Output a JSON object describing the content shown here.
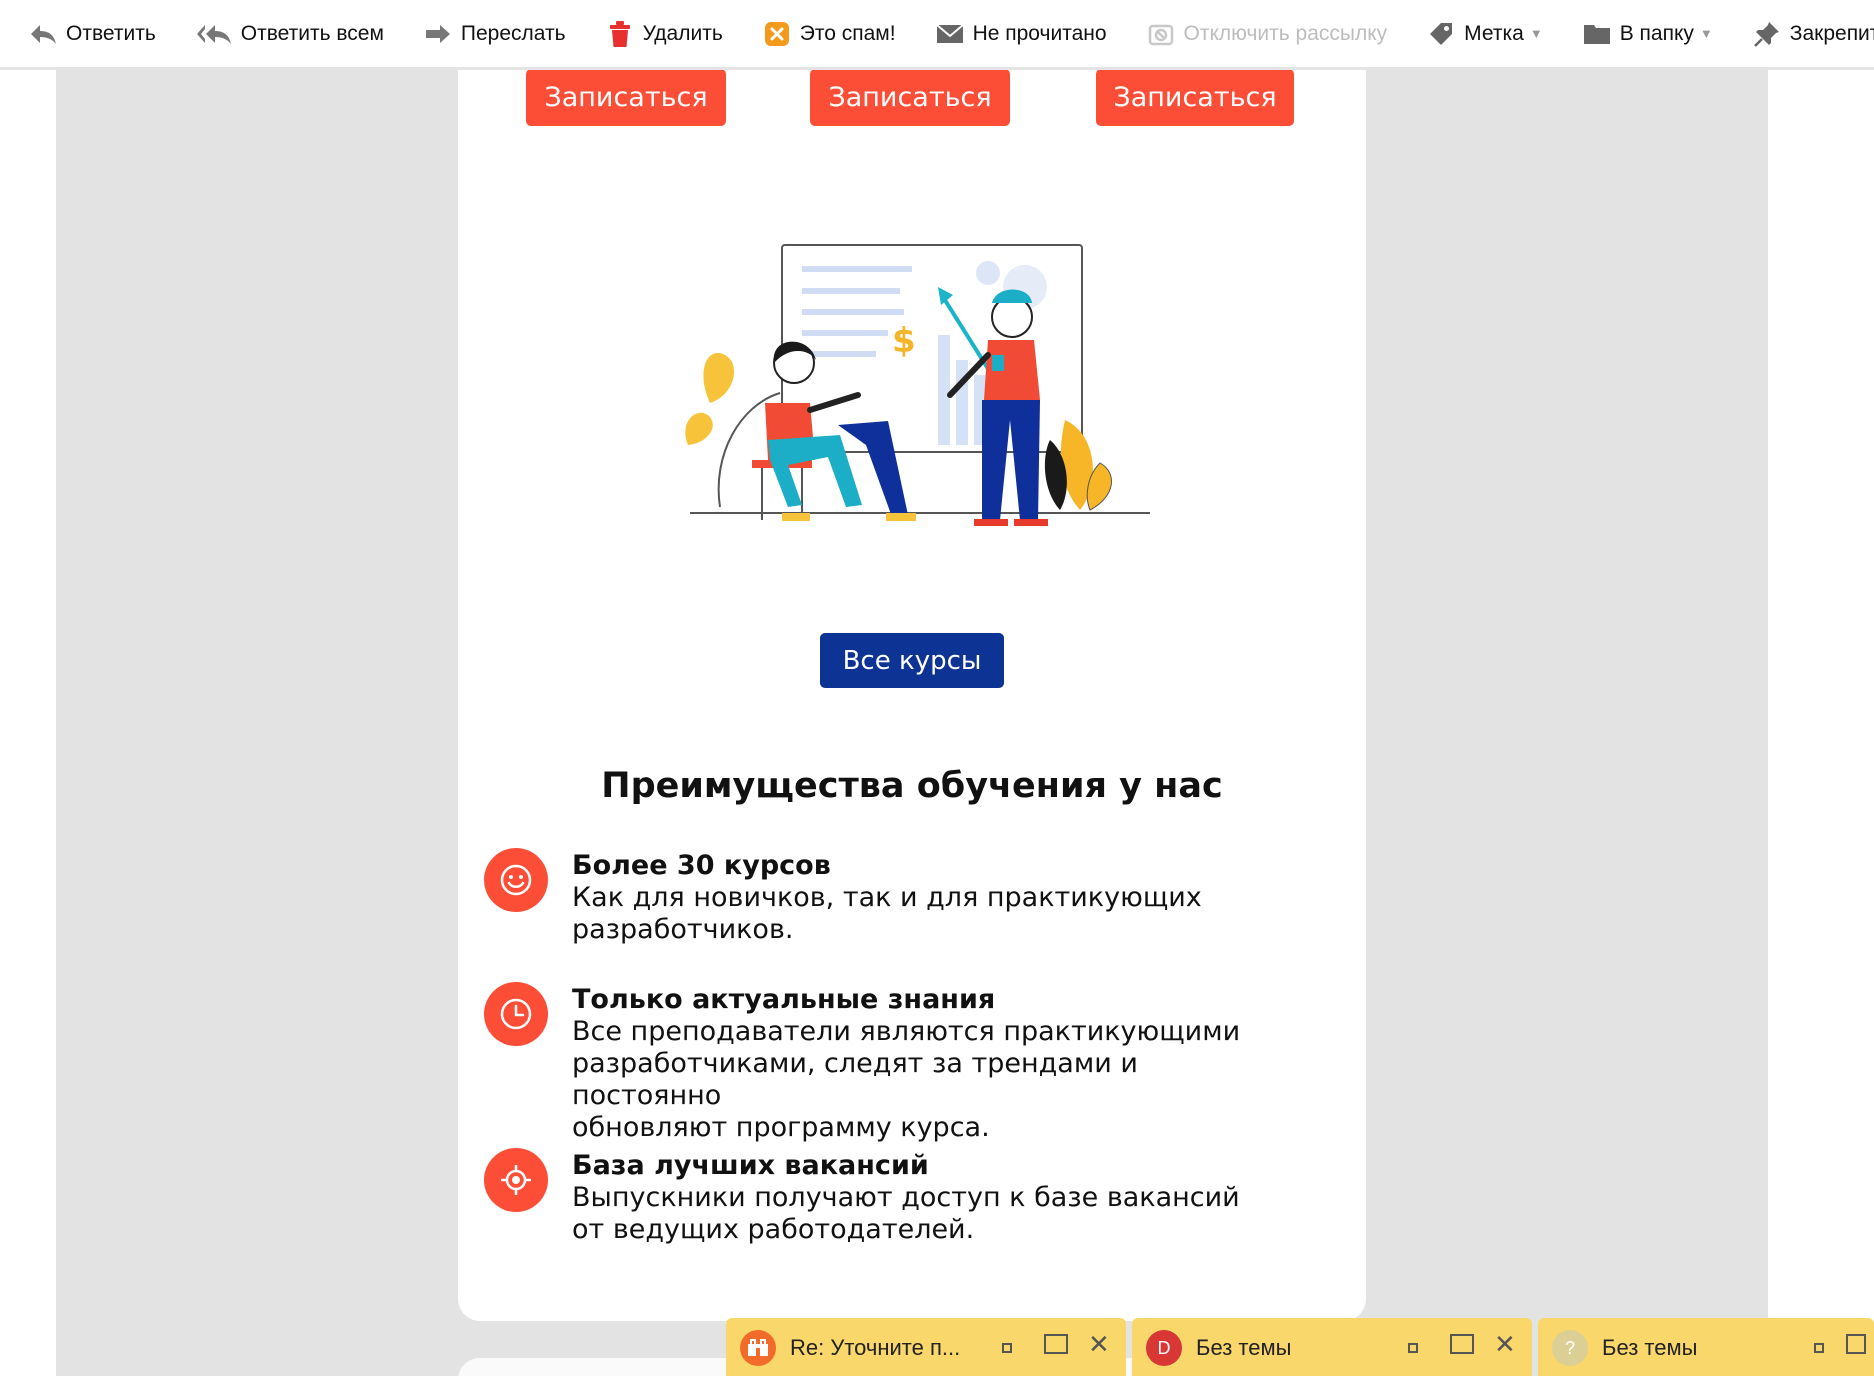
{
  "toolbar": {
    "reply": "Ответить",
    "reply_all": "Ответить всем",
    "forward": "Переслать",
    "delete": "Удалить",
    "spam": "Это спам!",
    "unread": "Не прочитано",
    "unsubscribe": "Отключить рассылку",
    "label": "Метка",
    "folder": "В папку",
    "pin": "Закрепить"
  },
  "email": {
    "signup_buttons": [
      "Записаться",
      "Записаться",
      "Записаться"
    ],
    "all_courses": "Все курсы",
    "advantages_title": "Преимущества обучения у нас",
    "advantages": [
      {
        "icon": "smile-icon",
        "title": "Более 30 курсов",
        "text": "Как для новичков, так и для практикующих\nразработчиков."
      },
      {
        "icon": "clock-icon",
        "title": "Только актуальные знания",
        "text": "Все преподаватели являются практикующими\nразработчиками, следят за трендами и постоянно\nобновляют программу курса."
      },
      {
        "icon": "target-icon",
        "title": "База лучших вакансий",
        "text": "Выпускники получают доступ к базе вакансий\nот ведущих работодателей."
      }
    ],
    "illustration_symbol": "$"
  },
  "tabs": [
    {
      "title": "Re: Уточните п...",
      "avatar": "",
      "avatar_color": "#f26b2b"
    },
    {
      "title": "Без темы",
      "avatar": "D",
      "avatar_color": "#d93636"
    },
    {
      "title": "Без темы",
      "avatar": "?",
      "avatar_color": "#dccf95"
    }
  ],
  "colors": {
    "accent": "#fc4d37",
    "primary": "#0d3394",
    "tab": "#f9d76a"
  }
}
